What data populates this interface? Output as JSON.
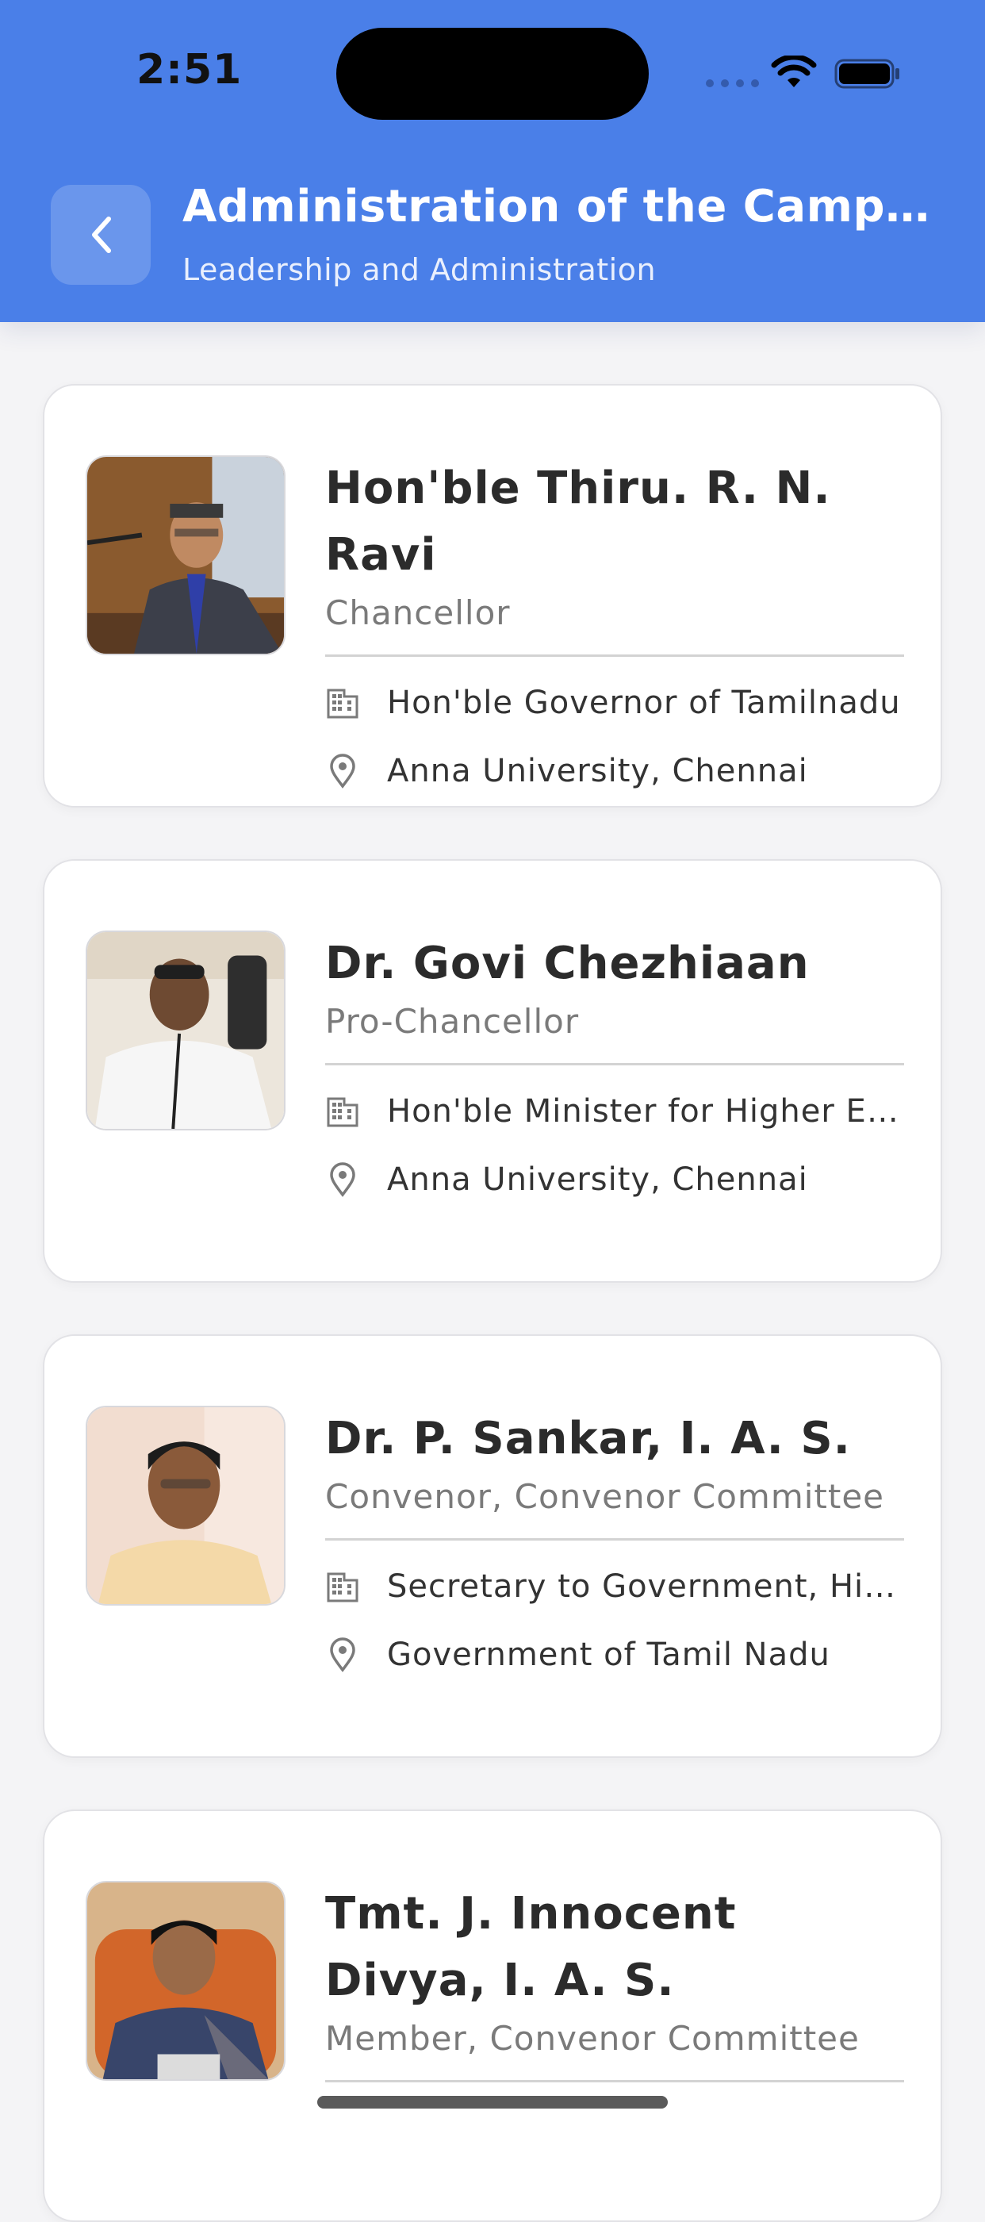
{
  "status_bar": {
    "time": "2:51"
  },
  "header": {
    "title": "Administration of the Campus...",
    "subtitle": "Leadership and Administration",
    "back_icon": "chevron-left-icon",
    "background_color": "#4a7fe8"
  },
  "people": [
    {
      "name": "Hon'ble Thiru. R. N. Ravi",
      "role": "Chancellor",
      "designation": "Hon'ble Governor of Tamilnadu",
      "location": "Anna University, Chennai"
    },
    {
      "name": "Dr. Govi Chezhiaan",
      "role": "Pro-Chancellor",
      "designation": "Hon'ble Minister for Higher Ed...",
      "location": "Anna University, Chennai"
    },
    {
      "name": "Dr. P. Sankar, I. A. S.",
      "role": "Convenor, Convenor Committee",
      "designation": "Secretary to Government, Hig...",
      "location": "Government of Tamil Nadu"
    },
    {
      "name": "Tmt. J. Innocent Divya, I. A. S.",
      "role": "Member, Convenor Committee"
    }
  ],
  "icons": {
    "designation": "building-icon",
    "location": "location-pin-icon"
  }
}
